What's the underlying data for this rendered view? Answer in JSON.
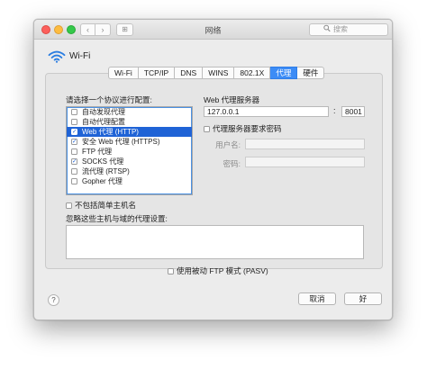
{
  "window": {
    "title": "网络"
  },
  "toolbar": {
    "back_glyph": "‹",
    "forward_glyph": "›",
    "grid_glyph": "⊞",
    "search_placeholder": "搜索",
    "search_icon": "magnifier-icon"
  },
  "header": {
    "interface_name": "Wi-Fi",
    "icon": "wifi-icon"
  },
  "tabs": [
    {
      "label": "Wi-Fi",
      "active": false
    },
    {
      "label": "TCP/IP",
      "active": false
    },
    {
      "label": "DNS",
      "active": false
    },
    {
      "label": "WINS",
      "active": false
    },
    {
      "label": "802.1X",
      "active": false
    },
    {
      "label": "代理",
      "active": true
    },
    {
      "label": "硬件",
      "active": false
    }
  ],
  "proxy": {
    "list_label": "请选择一个协议进行配置:",
    "protocols": [
      {
        "label": "自动发现代理",
        "checked": false,
        "selected": false
      },
      {
        "label": "自动代理配置",
        "checked": false,
        "selected": false
      },
      {
        "label": "Web 代理 (HTTP)",
        "checked": true,
        "selected": true
      },
      {
        "label": "安全 Web 代理 (HTTPS)",
        "checked": true,
        "selected": false
      },
      {
        "label": "FTP 代理",
        "checked": false,
        "selected": false
      },
      {
        "label": "SOCKS 代理",
        "checked": true,
        "selected": false
      },
      {
        "label": "流代理 (RTSP)",
        "checked": false,
        "selected": false
      },
      {
        "label": "Gopher 代理",
        "checked": false,
        "selected": false
      }
    ],
    "server_label": "Web 代理服务器",
    "server_value": "127.0.0.1",
    "port_separator": ":",
    "port_value": "8001",
    "require_password_label": "代理服务器要求密码",
    "username_label": "用户名:",
    "password_label": "密码:",
    "exclude_simple_label": "不包括简单主机名",
    "bypass_label": "忽略这些主机与域的代理设置:",
    "bypass_value": "",
    "passive_ftp_label": "使用被动 FTP 模式 (PASV)"
  },
  "footer": {
    "help_label": "?",
    "cancel_label": "取消",
    "ok_label": "好"
  },
  "colors": {
    "accent": "#3c8cf6",
    "selection": "#1f63d6"
  }
}
